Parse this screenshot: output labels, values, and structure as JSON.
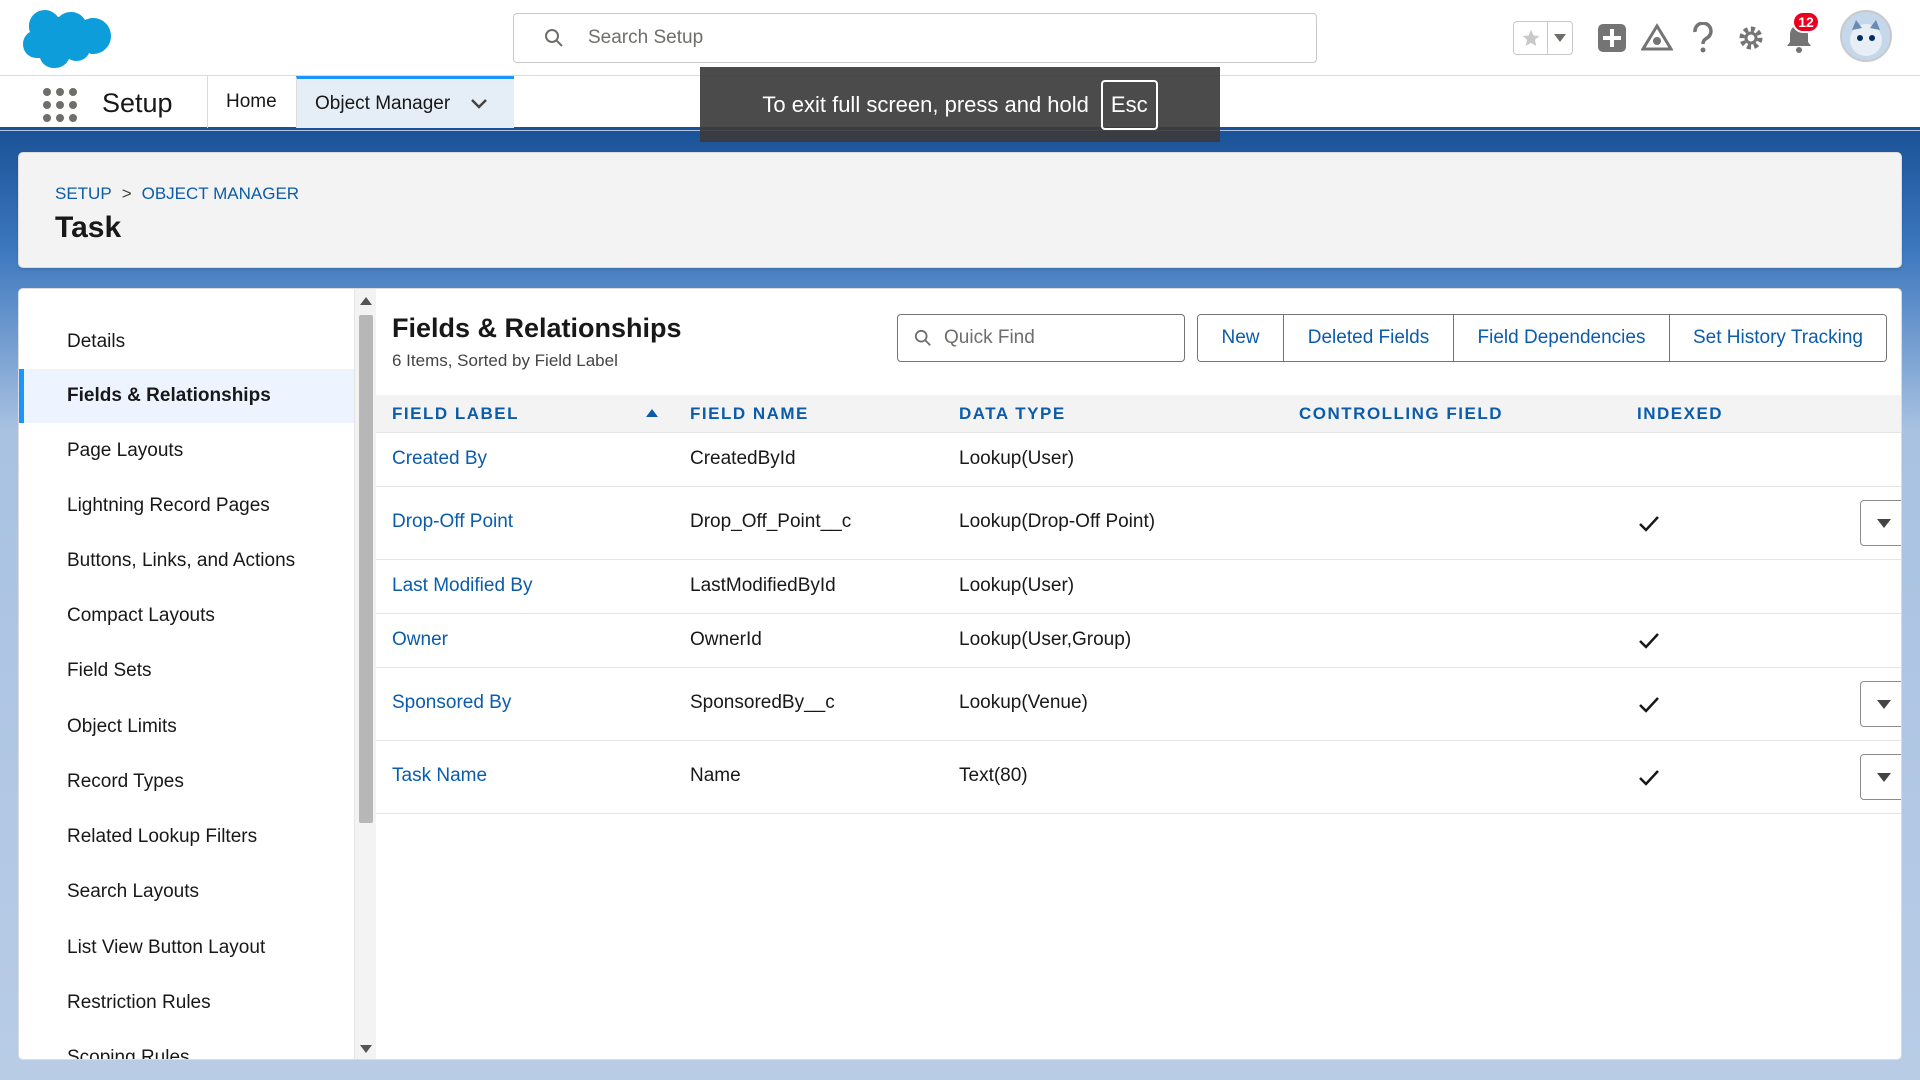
{
  "header": {
    "search_placeholder": "Search Setup",
    "notification_count": "12"
  },
  "nav": {
    "app_name": "Setup",
    "home": "Home",
    "object_manager": "Object Manager"
  },
  "toast": {
    "message": "To exit full screen, press and hold",
    "key": "Esc"
  },
  "breadcrumb": {
    "setup": "SETUP",
    "separator": ">",
    "object_manager": "OBJECT MANAGER"
  },
  "page_title": "Task",
  "sidebar": {
    "items": [
      {
        "label": "Details"
      },
      {
        "label": "Fields & Relationships"
      },
      {
        "label": "Page Layouts"
      },
      {
        "label": "Lightning Record Pages"
      },
      {
        "label": "Buttons, Links, and Actions"
      },
      {
        "label": "Compact Layouts"
      },
      {
        "label": "Field Sets"
      },
      {
        "label": "Object Limits"
      },
      {
        "label": "Record Types"
      },
      {
        "label": "Related Lookup Filters"
      },
      {
        "label": "Search Layouts"
      },
      {
        "label": "List View Button Layout"
      },
      {
        "label": "Restriction Rules"
      },
      {
        "label": "Scoping Rules"
      }
    ],
    "active_index": 1
  },
  "section": {
    "title": "Fields & Relationships",
    "subtitle": "6 Items, Sorted by Field Label",
    "quick_find_placeholder": "Quick Find",
    "buttons": {
      "new": "New",
      "deleted_fields": "Deleted Fields",
      "field_dependencies": "Field Dependencies",
      "set_history_tracking": "Set History Tracking"
    }
  },
  "table": {
    "headers": {
      "field_label": "FIELD LABEL",
      "field_name": "FIELD NAME",
      "data_type": "DATA TYPE",
      "controlling_field": "CONTROLLING FIELD",
      "indexed": "INDEXED"
    },
    "sorted_by": "field_label",
    "sort_direction": "ascending",
    "rows": [
      {
        "label": "Created By",
        "name": "CreatedById",
        "type": "Lookup(User)",
        "controlling": "",
        "indexed": false,
        "has_menu": false
      },
      {
        "label": "Drop-Off Point",
        "name": "Drop_Off_Point__c",
        "type": "Lookup(Drop-Off Point)",
        "controlling": "",
        "indexed": true,
        "has_menu": true
      },
      {
        "label": "Last Modified By",
        "name": "LastModifiedById",
        "type": "Lookup(User)",
        "controlling": "",
        "indexed": false,
        "has_menu": false
      },
      {
        "label": "Owner",
        "name": "OwnerId",
        "type": "Lookup(User,Group)",
        "controlling": "",
        "indexed": true,
        "has_menu": false
      },
      {
        "label": "Sponsored By",
        "name": "SponsoredBy__c",
        "type": "Lookup(Venue)",
        "controlling": "",
        "indexed": true,
        "has_menu": true
      },
      {
        "label": "Task Name",
        "name": "Name",
        "type": "Text(80)",
        "controlling": "",
        "indexed": true,
        "has_menu": true
      }
    ]
  },
  "colors": {
    "brand_blue": "#0b5cab",
    "accent_blue": "#1b96ff",
    "header_band": "#1b5297",
    "badge_red": "#ea001e"
  }
}
